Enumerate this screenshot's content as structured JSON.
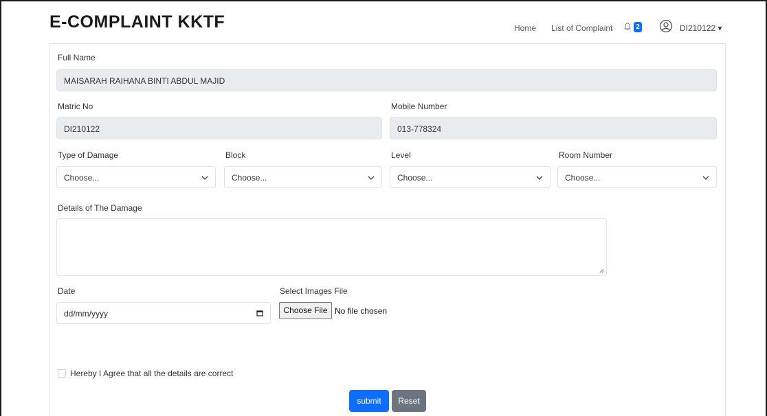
{
  "header": {
    "brand": "E-COMPLAINT KKTF",
    "nav": {
      "home": "Home",
      "list": "List of Complaint"
    },
    "notification_count": "2",
    "user": "DI210122 ▾"
  },
  "form": {
    "full_name": {
      "label": "Full Name",
      "value": "MAISARAH RAIHANA BINTI ABDUL MAJID"
    },
    "matric_no": {
      "label": "Matric No",
      "value": "DI210122"
    },
    "mobile": {
      "label": "Mobile Number",
      "value": "013-778324"
    },
    "damage_type": {
      "label": "Type of Damage",
      "value": "Choose..."
    },
    "block": {
      "label": "Block",
      "value": "Choose..."
    },
    "level": {
      "label": "Level",
      "value": "Choose..."
    },
    "room": {
      "label": "Room Number",
      "value": "Choose..."
    },
    "details": {
      "label": "Details of The Damage",
      "value": ""
    },
    "date": {
      "label": "Date",
      "value": "dd/mm/yyyy"
    },
    "images": {
      "label": "Select Images File",
      "button": "Choose File",
      "status": "No file chosen"
    },
    "agree_label": "Hereby I Agree that all the details are correct",
    "submit_label": "submit",
    "reset_label": "Reset"
  },
  "icons": {
    "bell": "bell-icon",
    "user": "user-circle-icon",
    "chevron": "chevron-down-icon",
    "calendar": "calendar-icon"
  },
  "colors": {
    "primary": "#0d6efd",
    "secondary": "#6c757d",
    "readonly_bg": "#e9ecef"
  }
}
